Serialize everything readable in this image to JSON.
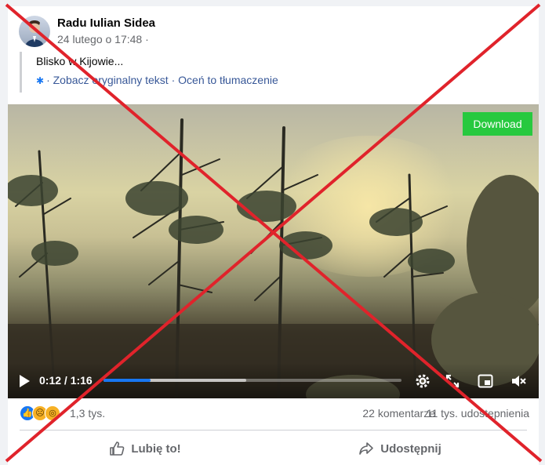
{
  "post": {
    "author": "Radu Iulian Sidea",
    "date": "24 lutego o 17:48 ·",
    "text": "Blisko w Kijowie...",
    "translation": {
      "see_original": "· Zobacz oryginalny tekst",
      "separator": " · ",
      "rate": "Oceń to tłumaczenie"
    }
  },
  "video": {
    "download_label": "Download",
    "time": "0:12 / 1:16",
    "progress": {
      "played": 0.158,
      "buffered": 0.48
    }
  },
  "stats": {
    "reaction_count": "1,3 tys.",
    "comments": "22 komentarze",
    "shares": "11 tys. udostępnienia"
  },
  "actions": {
    "like": "Lubię to!",
    "share": "Udostępnij"
  },
  "colors": {
    "accent": "#1877f2",
    "download": "#27c93f",
    "cross": "#e0232b"
  }
}
